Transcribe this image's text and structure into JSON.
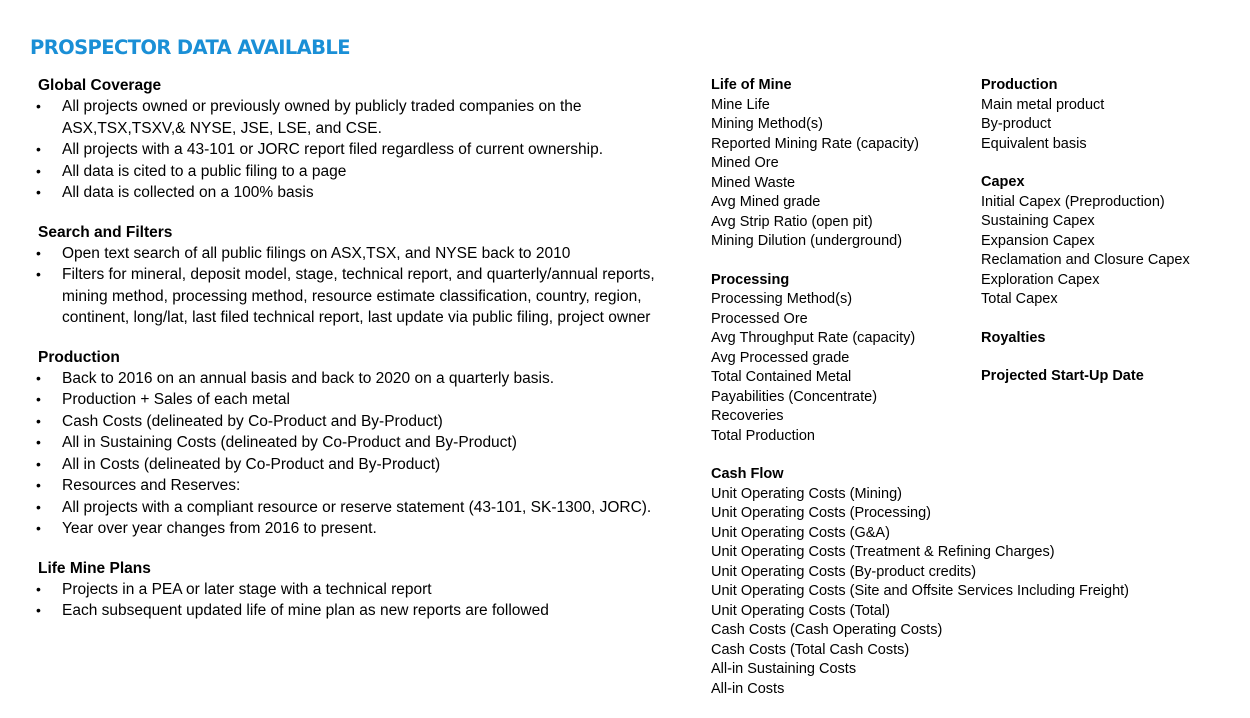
{
  "title": "PROSPECTOR DATA AVAILABLE",
  "accent_color": "#1a8fd6",
  "left_sections": [
    {
      "heading": "Global Coverage",
      "bullets": [
        "All projects owned or previously owned by publicly traded companies on the ASX,TSX,TSXV,& NYSE, JSE, LSE, and CSE.",
        "All projects with a 43-101 or JORC report filed regardless of current ownership.",
        "All data is cited to a public filing to a page",
        "All data is collected on a 100% basis"
      ]
    },
    {
      "heading": "Search and Filters",
      "bullets": [
        "Open text search of all public filings on ASX,TSX, and NYSE back to 2010",
        "Filters for mineral, deposit model, stage, technical report, and quarterly/annual reports, mining method, processing method, resource estimate classification, country, region, continent, long/lat, last filed technical report, last update via public filing, project owner"
      ]
    },
    {
      "heading": "Production",
      "bullets": [
        "Back to 2016 on an annual basis and back to 2020 on a quarterly basis.",
        "Production + Sales of each metal",
        "Cash Costs (delineated by Co-Product and By-Product)",
        "All in Sustaining Costs  (delineated by Co-Product and By-Product)",
        "All in Costs  (delineated by Co-Product and By-Product)",
        "Resources and Reserves:",
        "All projects with a compliant resource or reserve statement (43-101, SK-1300, JORC).",
        "Year over year changes from 2016 to present."
      ]
    },
    {
      "heading": "Life Mine Plans",
      "bullets": [
        "Projects in a PEA or later stage with a technical report",
        "Each subsequent updated life of mine plan as new reports are followed"
      ]
    }
  ],
  "bullet_char": "•",
  "mid_column": [
    {
      "heading": "Life of Mine",
      "items": [
        "Mine Life",
        "Mining Method(s)",
        "Reported Mining Rate (capacity)",
        "Mined Ore",
        "Mined Waste",
        "Avg Mined grade",
        "Avg Strip Ratio (open pit)",
        "Mining Dilution (underground)"
      ]
    },
    {
      "heading": "Processing",
      "items": [
        "Processing Method(s)",
        "Processed Ore",
        "Avg Throughput Rate (capacity)",
        "Avg Processed grade",
        "Total Contained Metal",
        "Payabilities (Concentrate)",
        "Recoveries",
        "Total Production"
      ]
    },
    {
      "heading": "Cash Flow",
      "items": [
        "Unit Operating Costs (Mining)",
        "Unit Operating Costs (Processing)",
        "Unit Operating Costs (G&A)",
        "Unit Operating Costs (Treatment & Refining Charges)",
        "Unit Operating Costs (By-product credits)",
        "Unit Operating Costs (Site and Offsite Services Including Freight)",
        "Unit Operating Costs (Total)",
        "Cash Costs (Cash Operating Costs)",
        "Cash Costs (Total Cash Costs)",
        "All-in Sustaining Costs",
        "All-in Costs"
      ]
    }
  ],
  "right_column": [
    {
      "heading": "Production",
      "items": [
        "Main metal product",
        "By-product",
        "Equivalent basis"
      ]
    },
    {
      "heading": "Capex",
      "items": [
        "Initial Capex (Preproduction)",
        "Sustaining Capex",
        "Expansion Capex",
        "Reclamation and Closure Capex",
        "Exploration Capex",
        "Total Capex"
      ]
    },
    {
      "heading": "Royalties",
      "items": []
    },
    {
      "heading": "Projected Start-Up Date",
      "items": []
    }
  ]
}
